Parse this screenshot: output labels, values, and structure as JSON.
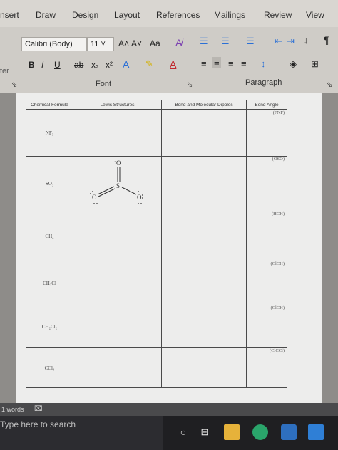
{
  "ribbon": {
    "tabs": [
      "nsert",
      "Draw",
      "Design",
      "Layout",
      "References",
      "Mailings",
      "Review",
      "View"
    ],
    "font_name": "Calibri (Body)",
    "font_size": "11",
    "grow_font": "A˄",
    "shrink_font": "A˅",
    "change_case": "Aa",
    "bold": "B",
    "italic": "I",
    "underline": "U",
    "strikethrough": "ab",
    "subscript": "x₂",
    "superscript": "x²",
    "left_cut_label": "ter",
    "font_group": "Font",
    "paragraph_group": "Paragraph",
    "pilcrow": "¶"
  },
  "table": {
    "headers": [
      "Chemical Formula",
      "Lewis Structures",
      "Bond and Molecular Dipoles",
      "Bond Angle"
    ],
    "first_angle": "(FNF)",
    "rows": [
      {
        "formula": "NF₃",
        "angle": ""
      },
      {
        "formula": "SO₃",
        "angle": "(OSO)"
      },
      {
        "formula": "CH₄",
        "angle": "(HCH)"
      },
      {
        "formula": "CH₃Cl",
        "angle": "(ClCH)"
      },
      {
        "formula": "CH₂Cl₂",
        "angle": "(ClCH)"
      },
      {
        "formula": "CCl₄",
        "angle": "(ClCCl)"
      }
    ],
    "lewis_so3": {
      "top": "O",
      "center": "S",
      "left": "O",
      "right": "O"
    }
  },
  "status": {
    "words": "1 words"
  },
  "taskbar": {
    "search_placeholder": "Type here to search"
  }
}
